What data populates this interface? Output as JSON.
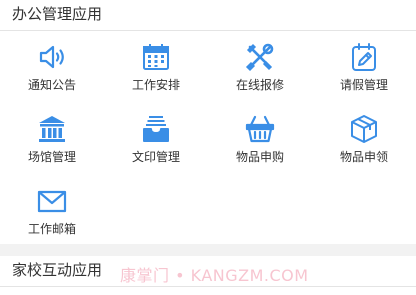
{
  "sections": {
    "office": {
      "title": "办公管理应用"
    },
    "home_school": {
      "title": "家校互动应用"
    }
  },
  "tiles": [
    {
      "label": "通知公告",
      "icon": "speaker-icon"
    },
    {
      "label": "工作安排",
      "icon": "calendar-icon"
    },
    {
      "label": "在线报修",
      "icon": "tools-icon"
    },
    {
      "label": "请假管理",
      "icon": "edit-note-icon"
    },
    {
      "label": "场馆管理",
      "icon": "building-icon"
    },
    {
      "label": "文印管理",
      "icon": "print-tray-icon"
    },
    {
      "label": "物品申购",
      "icon": "basket-icon"
    },
    {
      "label": "物品申领",
      "icon": "box-icon"
    },
    {
      "label": "工作邮箱",
      "icon": "mail-icon"
    }
  ],
  "watermark": "康掌门 • KANGZM.COM",
  "colors": {
    "icon": "#3a8ee6",
    "text": "#333333",
    "gap": "#f2f2f2",
    "divider": "#e4e4e4"
  }
}
